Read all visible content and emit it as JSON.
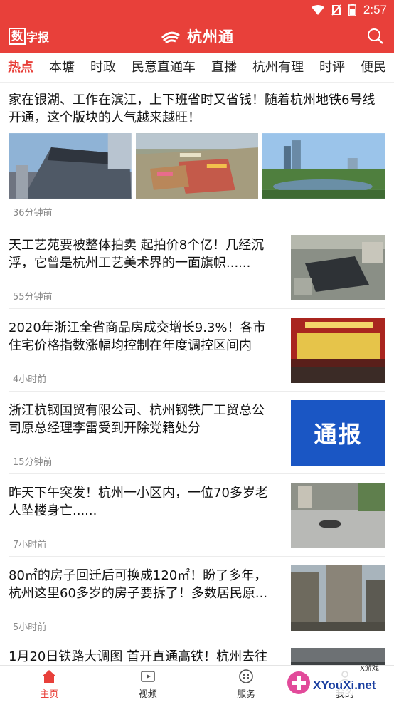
{
  "status_bar": {
    "time": "2:57"
  },
  "header": {
    "paper_box": "数",
    "paper_rest": "字报",
    "title": "杭州通"
  },
  "tabs": [
    "热点",
    "本塘",
    "时政",
    "民意直通车",
    "直播",
    "杭州有理",
    "时评",
    "便民"
  ],
  "active_tab": "热点",
  "feed": [
    {
      "title": "家在银湖、工作在滨江，上下班省时又省钱！随着杭州地铁6号线开通，这个版块的人气越来越旺！",
      "time": "36分钟前"
    },
    {
      "title": "天工艺苑要被整体拍卖 起拍价8个亿！几经沉浮，它曾是杭州工艺美术界的一面旗帜......",
      "time": "55分钟前"
    },
    {
      "title": "2020年浙江全省商品房成交增长9.3%！各市住宅价格指数涨幅均控制在年度调控区间内",
      "time": "4小时前"
    },
    {
      "title": "浙江杭钢国贸有限公司、杭州钢铁厂工贸总公司原总经理李雷受到开除党籍处分",
      "time": "15分钟前",
      "thumb_text": "通报"
    },
    {
      "title": "昨天下午突发！杭州一小区内，一位70多岁老人坠楼身亡......",
      "time": "7小时前"
    },
    {
      "title": "80㎡的房子回迁后可换成120㎡！盼了多年，杭州这里60多岁的房子要拆了！多数居民原...",
      "time": "5小时前"
    },
    {
      "title": "1月20日铁路大调图 首开直通高铁！杭州去往"
    }
  ],
  "bottom_nav": [
    "主页",
    "视频",
    "服务",
    "我的"
  ],
  "watermark": {
    "tag": "X游戏",
    "site": "XYouXi.net"
  },
  "colors": {
    "brand": "#e8403a"
  }
}
